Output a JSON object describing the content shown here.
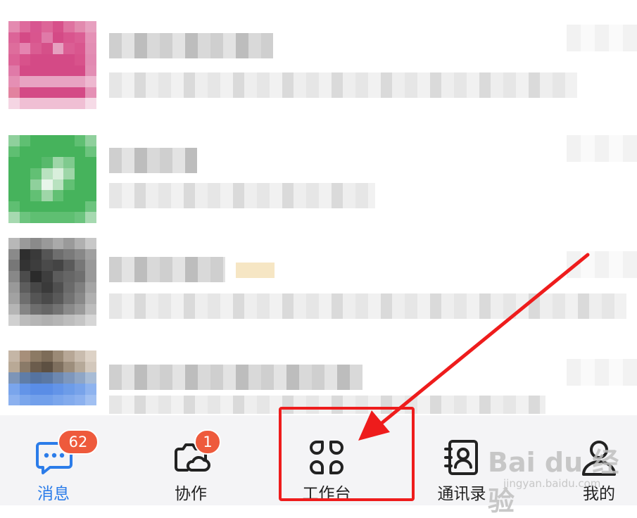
{
  "chat_list": {
    "rows": [
      {
        "name_blurred": true,
        "preview_blurred": true
      },
      {
        "name_blurred": true,
        "preview_blurred": true
      },
      {
        "name_blurred": true,
        "preview_blurred": true
      },
      {
        "name_blurred": true,
        "preview_blurred": true
      }
    ]
  },
  "tab_bar": {
    "tabs": [
      {
        "label": "消息",
        "icon": "chat-bubble-icon",
        "badge": "62",
        "active": true
      },
      {
        "label": "协作",
        "icon": "collaboration-icon",
        "badge": "1",
        "active": false
      },
      {
        "label": "工作台",
        "icon": "workbench-grid-icon",
        "badge": "",
        "active": false
      },
      {
        "label": "通讯录",
        "icon": "contacts-book-icon",
        "badge": "",
        "active": false
      },
      {
        "label": "我的",
        "icon": "profile-icon",
        "badge": "",
        "active": false
      }
    ]
  },
  "annotation": {
    "highlight_color": "#ee1c1c"
  },
  "watermark": {
    "logo": "Bai du 经验",
    "url": "jingyan.baidu.com"
  },
  "colors": {
    "accent": "#2b7ce9",
    "badge": "#ee5a3c"
  }
}
